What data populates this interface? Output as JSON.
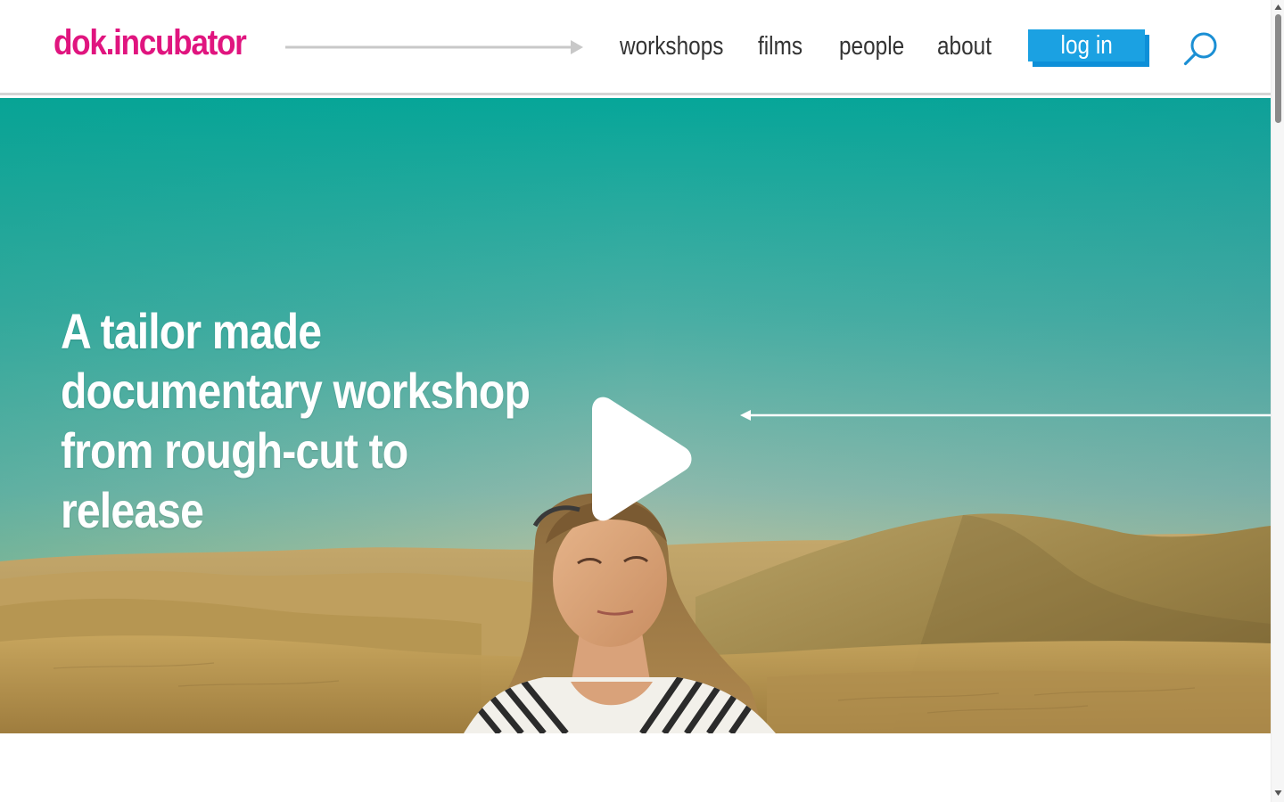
{
  "brand": {
    "logo_text": "dok.incubator",
    "logo_color": "#e0157f"
  },
  "nav": {
    "items": [
      {
        "label": "workshops"
      },
      {
        "label": "films"
      },
      {
        "label": "people"
      },
      {
        "label": "about"
      }
    ],
    "login_label": "log in",
    "login_color": "#1ba1e2",
    "login_shadow_color": "#0d8fd8",
    "search_icon": "search-icon",
    "search_color": "#1b8fd4"
  },
  "hero": {
    "title": "A tailor made documentary workshop from rough-cut to release",
    "play_icon": "play-icon",
    "colors": {
      "sky_top": "#0aa89a",
      "sky_mid": "#6fb4ac",
      "horizon": "#c9c79a",
      "sand_light": "#c9a866",
      "sand_dark": "#8a6c38"
    }
  }
}
